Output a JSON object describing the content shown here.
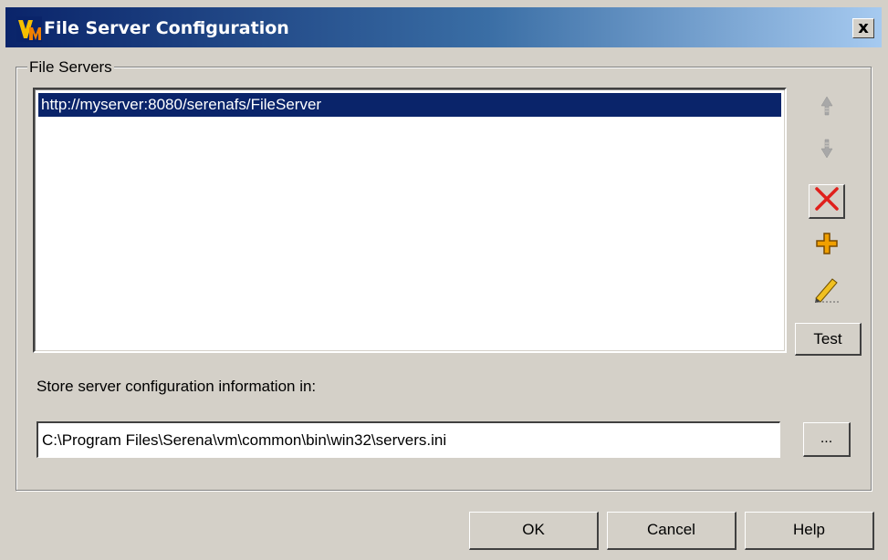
{
  "window": {
    "title": "File Server Configuration",
    "close_label": "x"
  },
  "file_servers": {
    "group_label": "File Servers",
    "items": [
      "http://myserver:8080/serenafs/FileServer"
    ],
    "selected_index": 0
  },
  "side_buttons": {
    "move_up_icon": "arrow-up-icon",
    "move_down_icon": "arrow-down-icon",
    "delete_icon": "delete-x-icon",
    "add_icon": "plus-icon",
    "edit_icon": "pencil-icon",
    "test_label": "Test"
  },
  "storage": {
    "label": "Store server configuration information in:",
    "path_value": "C:\\Program Files\\Serena\\vm\\common\\bin\\win32\\servers.ini",
    "browse_label": "..."
  },
  "footer": {
    "ok_label": "OK",
    "cancel_label": "Cancel",
    "help_label": "Help"
  },
  "colors": {
    "title_gradient_start": "#0a246a",
    "title_gradient_end": "#a6caf0",
    "selection": "#0a246a",
    "delete_red": "#e0201c",
    "add_orange": "#f0a000"
  }
}
